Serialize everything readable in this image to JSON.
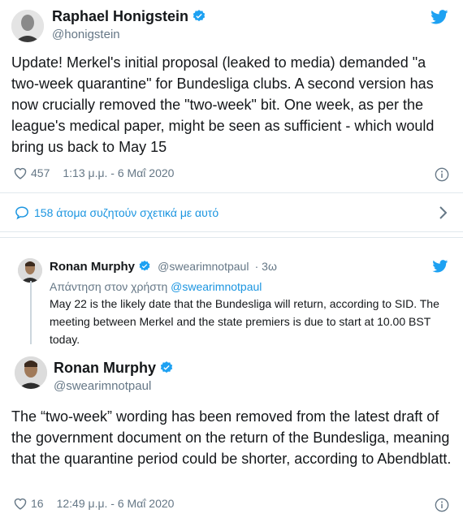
{
  "tweet1": {
    "name": "Raphael Honigstein",
    "handle": "@honigstein",
    "text": "Update! Merkel's initial proposal (leaked to media) demanded \"a two-week quarantine\" for Bundesliga clubs. A second version has now crucially removed the \"two-week\" bit. One week, as per the league's medical paper, might be seen as sufficient - which would bring us back to May 15",
    "likes": "457",
    "timestamp": "1:13 μ.μ. - 6 Μαΐ 2020",
    "discussion": "158 άτομα συζητούν σχετικά με αυτό"
  },
  "tweet2": {
    "parent": {
      "name": "Ronan Murphy",
      "handle": "@swearimnotpaul",
      "age": "· 3ω",
      "reply_prefix": "Απάντηση στον χρήστη",
      "reply_to": "@swearimnotpaul",
      "text": "May 22 is the likely date that the Bundesliga will return, according to SID. The meeting between Merkel and the state premiers is due to start at 10.00 BST today."
    },
    "name": "Ronan Murphy",
    "handle": "@swearimnotpaul",
    "text": "The “two-week” wording has been removed from the latest draft of the government document on the return of the Bundesliga, meaning that the quarantine period could be shorter, according to Abendblatt.",
    "likes": "16",
    "timestamp": "12:49 μ.μ. - 6 Μαΐ 2020"
  },
  "colors": {
    "link": "#1b95e0",
    "verified": "#1da1f2",
    "secondary": "#657786"
  },
  "icons": {
    "twitter": "twitter-bird-icon",
    "verified": "verified-badge-icon",
    "like": "heart-icon",
    "info": "info-icon",
    "reply": "speech-bubble-icon",
    "chevron": "chevron-right-icon"
  }
}
